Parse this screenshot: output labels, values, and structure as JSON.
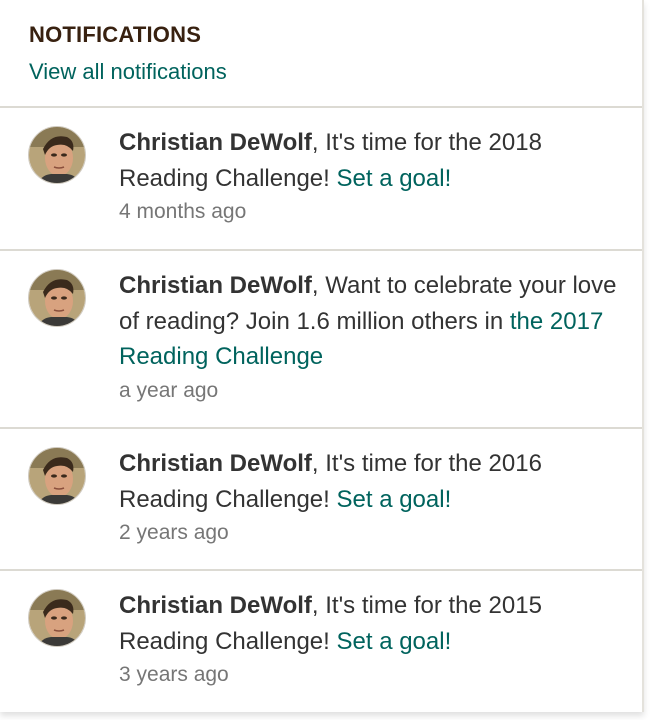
{
  "header": {
    "title": "NOTIFICATIONS",
    "view_all_label": "View all notifications"
  },
  "notifications": [
    {
      "actor": "Christian DeWolf",
      "comma": ",",
      "text": " It's time for the 2018 Reading Challenge! ",
      "link": "Set a goal!",
      "time": "4 months ago"
    },
    {
      "actor": "Christian DeWolf",
      "comma": ",",
      "text": " Want to celebrate your love of reading? Join 1.6 million others in ",
      "link": "the 2017 Reading Challenge",
      "time": "a year ago"
    },
    {
      "actor": "Christian DeWolf",
      "comma": ",",
      "text": " It's time for the 2016 Reading Challenge! ",
      "link": "Set a goal!",
      "time": "2 years ago"
    },
    {
      "actor": "Christian DeWolf",
      "comma": ",",
      "text": " It's time for the 2015 Reading Challenge! ",
      "link": "Set a goal!",
      "time": "3 years ago"
    }
  ],
  "colors": {
    "heading": "#382110",
    "link": "#00635d",
    "body_text": "#333333",
    "timestamp": "#767676",
    "divider": "#dcdad3"
  },
  "icons": {
    "avatar": "user-avatar-photo"
  }
}
